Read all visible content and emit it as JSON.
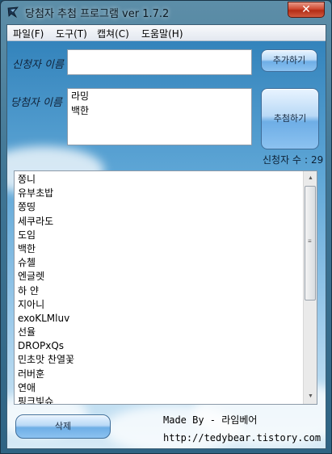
{
  "window": {
    "title": "당첨자 추첨 프로그램 ver 1.7.2",
    "close_glyph": "✕"
  },
  "menu": {
    "items": [
      {
        "label": "파일(F)"
      },
      {
        "label": "도구(T)"
      },
      {
        "label": "캡쳐(C)"
      },
      {
        "label": "도움말(H)"
      }
    ]
  },
  "form": {
    "applicant_label": "신청자 이름",
    "applicant_value": "",
    "add_button": "추가하기",
    "winner_label": "당첨자 이름",
    "winners": [
      "라밍",
      "백한"
    ],
    "draw_button": "추첨하기",
    "count_label": "신청자 수",
    "count_separator": ":",
    "count_value": "29"
  },
  "applicants": [
    "쫑니",
    "유부초밥",
    "쫑띵",
    "세쿠라도",
    "도임",
    "백한",
    "슈첼",
    "엔글렛",
    "하 얀",
    "지아니",
    "exoKLMluv",
    "선율",
    "DROPxQs",
    "민초맛 찬열꽃",
    "러버훈",
    "연애",
    "핑크빛슈"
  ],
  "delete_button": "삭제",
  "credit": {
    "made_by": "Made By - 라임베어",
    "url": "http://tedybear.tistory.com"
  },
  "scrollbar": {
    "up_glyph": "▲",
    "down_glyph": "▼",
    "grip_glyph": "≡"
  }
}
